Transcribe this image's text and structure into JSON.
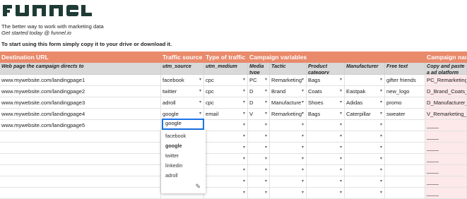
{
  "brand": {
    "name": "funnel",
    "tagline": "The better way to work with marketing data",
    "tagline2": "Get started today @ funnel.io",
    "instruction": "To start using this form simply copy it to your drive or download it."
  },
  "header": [
    "Destination URL",
    "Traffic source",
    "Type of traffic",
    "Campaign variables",
    "",
    "",
    "",
    "",
    "",
    "Campaign nam"
  ],
  "subheader": [
    "Web page the campaign directs to",
    "utm_source",
    "utm_medium",
    "Media type",
    "Tactic",
    "Product category",
    "Manufacturer",
    "Free text",
    "Copy and paste a ad platform"
  ],
  "rows": [
    [
      "www.mywebsite.com/landingpage1",
      "facebook",
      "cpc",
      "PC",
      "Remarketing",
      "Bags",
      "",
      "gifter friends",
      "PC_Remarketing_"
    ],
    [
      "www.mywebsite.com/landingpage2",
      "twitter",
      "cpc",
      "D",
      "Brand",
      "Coats",
      "Eastpak",
      "new_logo",
      "D_Brand_Coats_"
    ],
    [
      "www.mywebsite.com/landingpage3",
      "adroll",
      "cpc",
      "D",
      "Manufacture",
      "Shoes",
      "Adidas",
      "promo",
      "D_Manufacturer_"
    ],
    [
      "www.mywebsite.com/landingpage4",
      "google",
      "email",
      "V",
      "Remarketing",
      "Bags",
      "Caterpillar",
      "sweater",
      "V_Remarketing_B"
    ],
    [
      "www.mywebsite.com/landingpage5",
      "google",
      "",
      "",
      "",
      "",
      "",
      "",
      "____"
    ]
  ],
  "dropdown": {
    "active_value": "google",
    "options": [
      "facebook",
      "google",
      "twitter",
      "linkedin",
      "adroll"
    ],
    "selected": "google"
  },
  "empty_name": "____",
  "colors": {
    "header": "#e98a6b",
    "subheader": "#d9d9d9",
    "name_col": "#fde9ea",
    "logo": "#1f3b35"
  }
}
